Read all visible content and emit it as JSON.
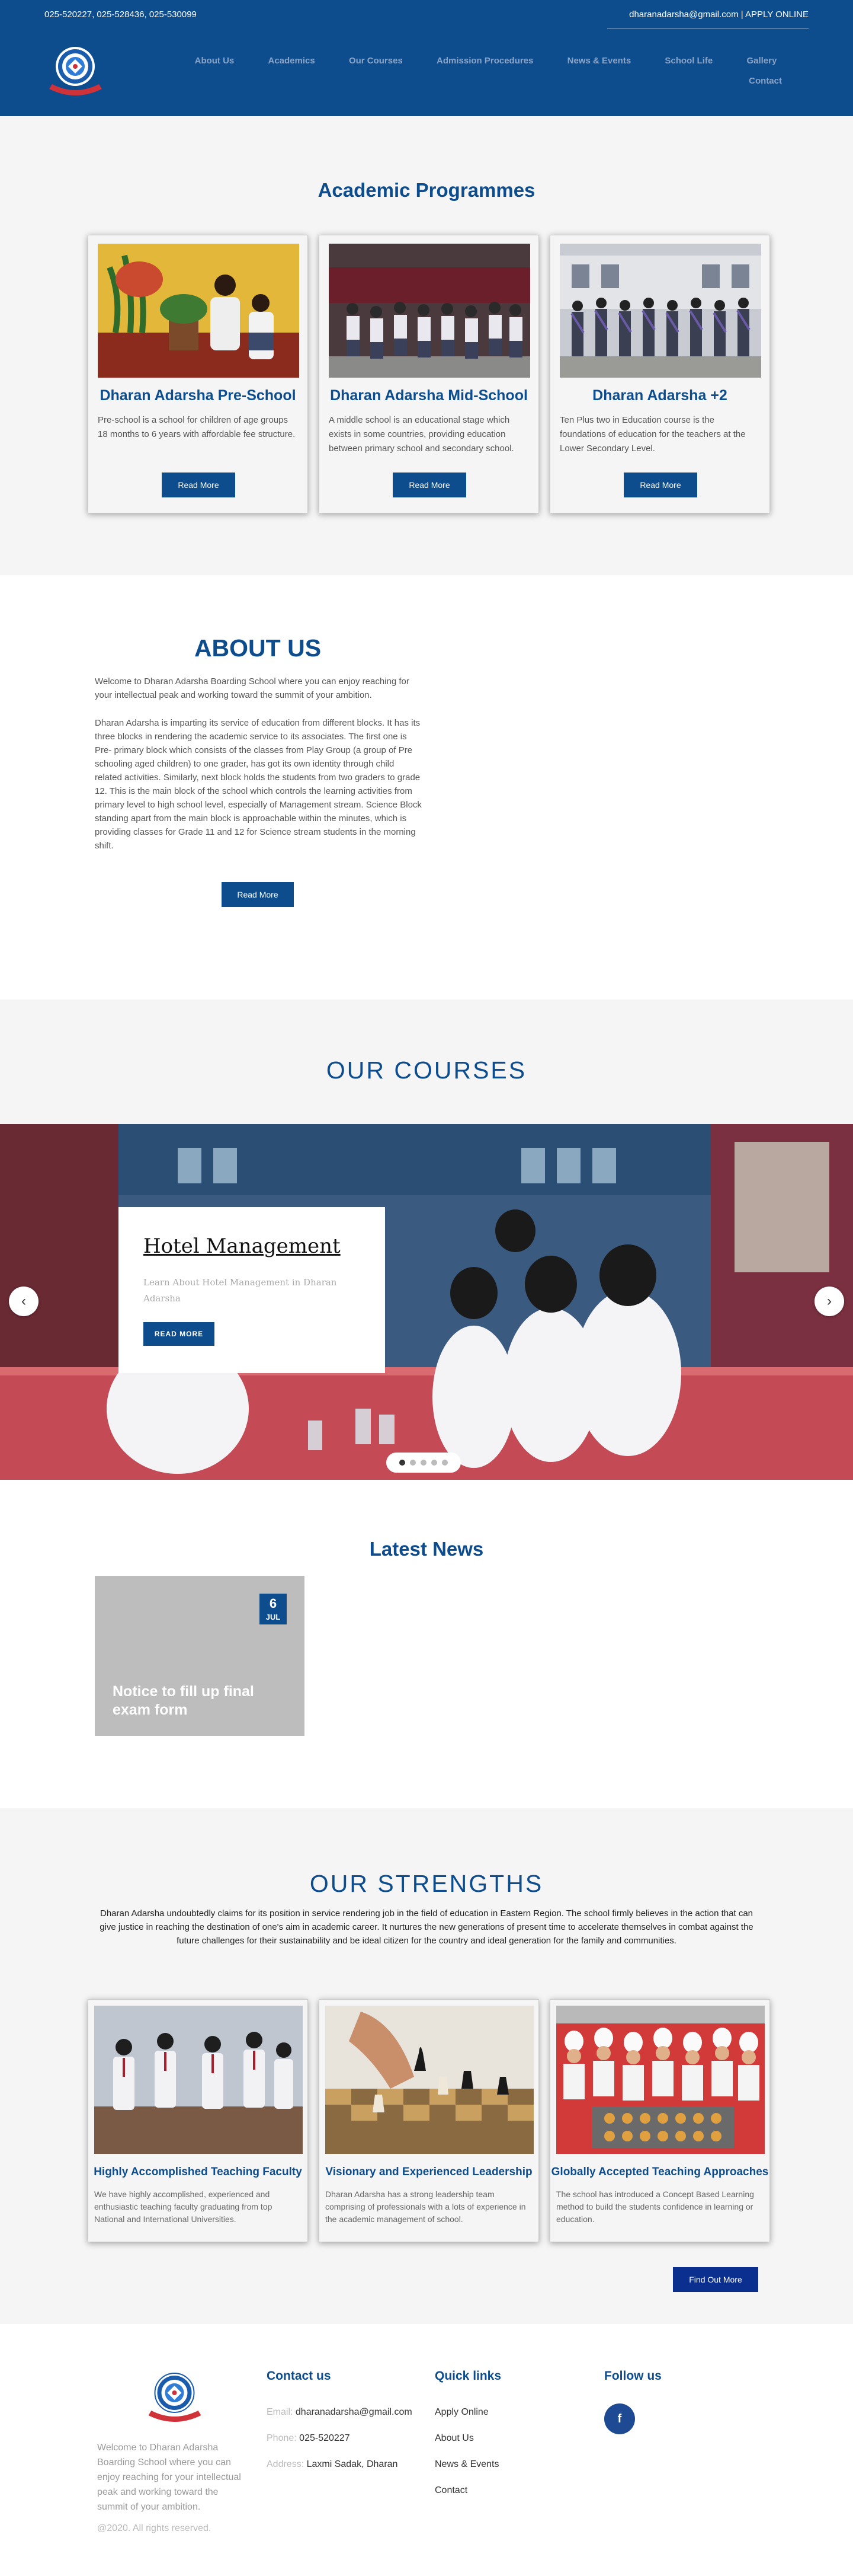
{
  "topbar": {
    "phones": "025-520227, 025-528436, 025-530099",
    "email_apply": "dharanadarsha@gmail.com | APPLY ONLINE"
  },
  "nav": {
    "items": [
      "About Us",
      "Academics",
      "Our Courses",
      "Admission Procedures",
      "News & Events",
      "School Life",
      "Gallery"
    ],
    "contact": "Contact"
  },
  "academic": {
    "title": "Academic Programmes",
    "cards": [
      {
        "title": "Dharan Adarsha Pre-School",
        "text": "Pre-school is a school for children of age groups 18 months to 6 years with affordable fee structure.",
        "button": "Read More"
      },
      {
        "title": "Dharan Adarsha Mid-School",
        "text": "A middle school is an educational stage which exists in some countries, providing education between primary school and secondary school.",
        "button": "Read More"
      },
      {
        "title": "Dharan Adarsha +2",
        "text": "Ten Plus two in Education course is the foundations of education for the teachers at the Lower Secondary Level.",
        "button": "Read More"
      }
    ]
  },
  "about": {
    "title": "ABOUT US",
    "p1": "Welcome to Dharan Adarsha Boarding School where you can enjoy reaching for your intellectual peak and working toward the summit of your ambition.",
    "p2": "Dharan Adarsha is imparting its service of education from different blocks. It has its three blocks in rendering the academic service to its associates. The first one is Pre- primary block which consists of the classes from Play Group (a group of Pre schooling aged children) to one grader, has got its own identity through child related activities. Similarly, next block holds the students from two graders to grade 12. This is the main block of the school which controls the learning activities from primary level to high school level, especially of Management stream. Science Block standing apart from the main block is approachable within the minutes, which is providing classes for Grade 11 and 12 for Science stream students in the morning shift.",
    "button": "Read More"
  },
  "courses": {
    "title": "OUR COURSES",
    "slide": {
      "title": "Hotel Management",
      "text": "Learn About Hotel Management in Dharan Adarsha",
      "button": "READ MORE"
    },
    "prev": "‹",
    "next": "›",
    "dots": 5,
    "active_dot": 0
  },
  "news": {
    "title": "Latest News",
    "item": {
      "day": "6",
      "month": "JUL",
      "title": "Notice to fill up final exam form"
    }
  },
  "strengths": {
    "title": "OUR STRENGTHS",
    "intro": "Dharan Adarsha undoubtedly claims for its position in service rendering job in the field of education in Eastern Region. The school firmly believes in the action that can give justice in reaching the destination of one's aim in academic career. It nurtures the new generations of present time to accelerate themselves in combat against the future challenges for their sustainability and be ideal citizen for the country and ideal generation for the family and communities.",
    "cards": [
      {
        "title": "Highly Accomplished Teaching Faculty",
        "text": "We have highly accomplished, experienced and enthusiastic teaching faculty graduating from top National and International Universities."
      },
      {
        "title": "Visionary and Experienced Leadership",
        "text": "Dharan Adarsha has a strong leadership team comprising of professionals with a lots of experience in the academic management of school."
      },
      {
        "title": "Globally Accepted Teaching Approaches",
        "text": "The school has introduced a Concept Based Learning method to build the students confidence in learning or education."
      }
    ],
    "button": "Find Out More"
  },
  "footer": {
    "about": "Welcome to Dharan Adarsha Boarding School where you can enjoy reaching for your intellectual peak and working toward the summit of your ambition.",
    "copyright": "@2020. All rights reserved.",
    "contact": {
      "title": "Contact us",
      "email_label": "Email:",
      "email": "dharanadarsha@gmail.com",
      "phone_label": "Phone:",
      "phone": "025-520227",
      "address_label": "Address:",
      "address": "Laxmi Sadak, Dharan"
    },
    "quick": {
      "title": "Quick links",
      "links": [
        "Apply Online",
        "About Us",
        "News & Events",
        "Contact"
      ]
    },
    "follow": {
      "title": "Follow us",
      "facebook": "f"
    }
  },
  "colors": {
    "primary": "#0d4d8e",
    "header": "#0d4d8e",
    "button_dark": "#0b2f8f",
    "news_card": "#bdbdbd"
  }
}
